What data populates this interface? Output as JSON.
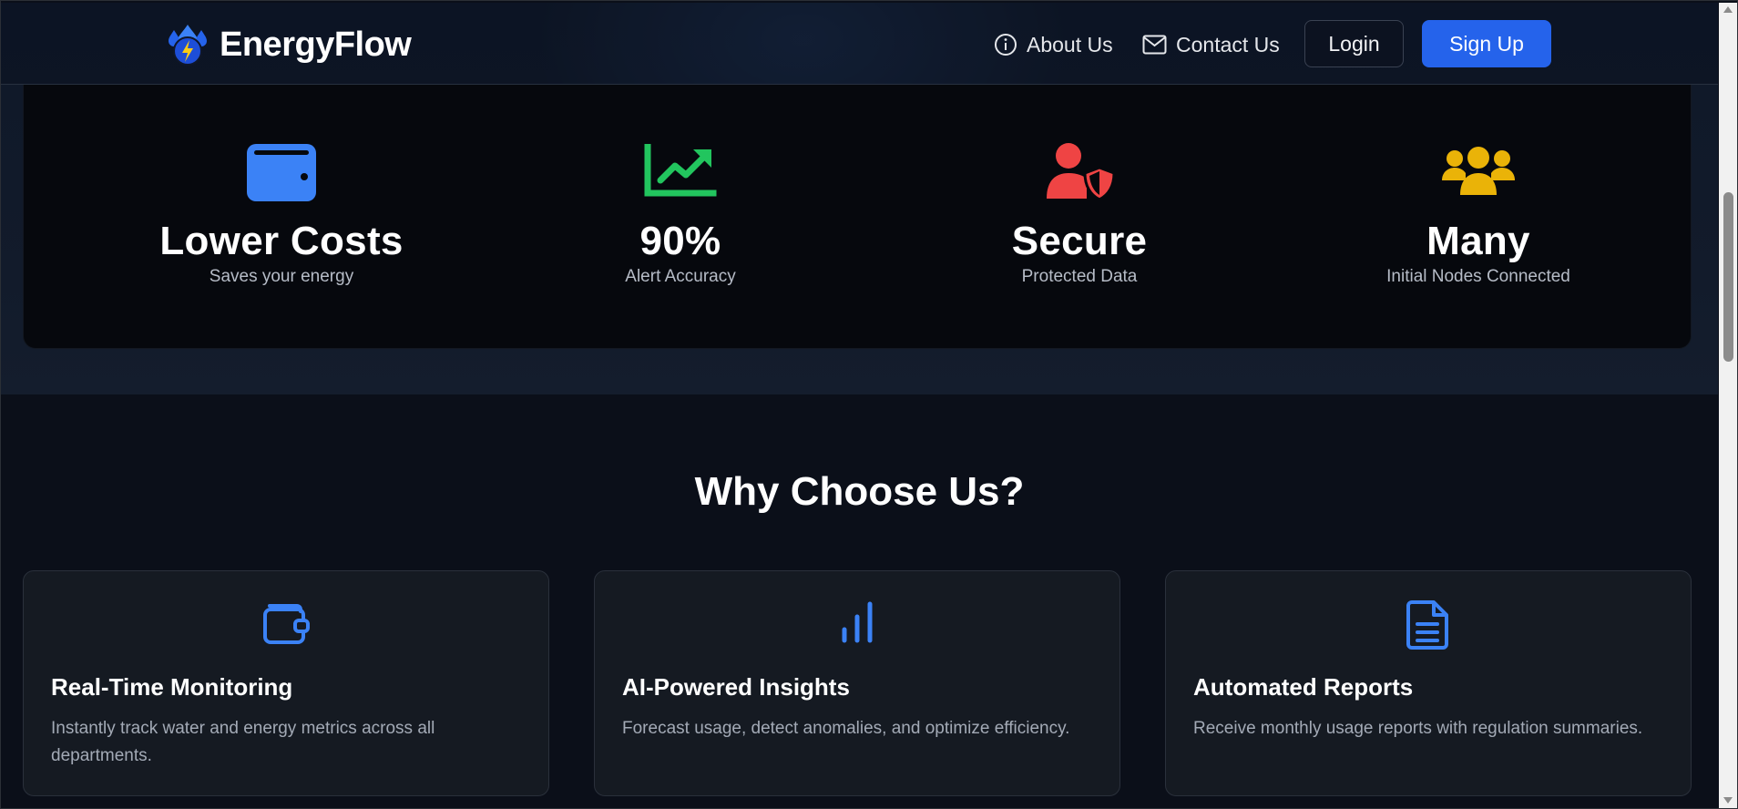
{
  "header": {
    "brand": "EnergyFlow",
    "nav": [
      {
        "label": "About Us",
        "icon": "info-icon"
      },
      {
        "label": "Contact Us",
        "icon": "mail-icon"
      }
    ],
    "login_label": "Login",
    "signup_label": "Sign Up"
  },
  "stats": [
    {
      "value": "Lower Costs",
      "label": "Saves your energy",
      "icon": "wallet-icon",
      "color": "#3b82f6"
    },
    {
      "value": "90%",
      "label": "Alert Accuracy",
      "icon": "chart-line-icon",
      "color": "#22c55e"
    },
    {
      "value": "Secure",
      "label": "Protected Data",
      "icon": "user-shield-icon",
      "color": "#ef4444"
    },
    {
      "value": "Many",
      "label": "Initial Nodes Connected",
      "icon": "users-icon",
      "color": "#eab308"
    }
  ],
  "why": {
    "title": "Why Choose Us?",
    "cards": [
      {
        "title": "Real-Time Monitoring",
        "description": "Instantly track water and energy metrics across all departments.",
        "icon": "wallet-outline-icon"
      },
      {
        "title": "AI-Powered Insights",
        "description": "Forecast usage, detect anomalies, and optimize efficiency.",
        "icon": "bar-chart-icon"
      },
      {
        "title": "Automated Reports",
        "description": "Receive monthly usage reports with regulation summaries.",
        "icon": "document-icon"
      }
    ]
  },
  "colors": {
    "accent": "#2563eb",
    "background": "#0b0f19",
    "card": "#151a22"
  }
}
